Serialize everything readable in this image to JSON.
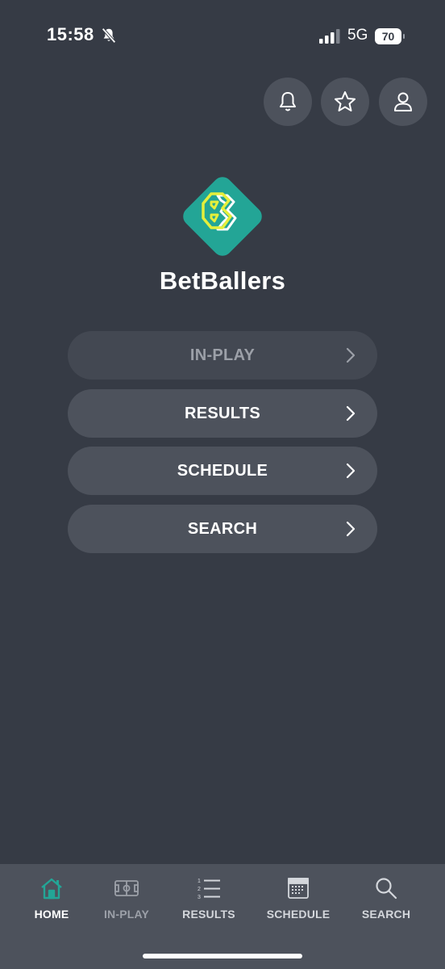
{
  "status_bar": {
    "time": "15:58",
    "network": "5G",
    "battery": "70"
  },
  "header": {
    "buttons": [
      {
        "icon": "bell-icon"
      },
      {
        "icon": "star-icon"
      },
      {
        "icon": "user-icon"
      }
    ]
  },
  "brand": {
    "name": "BetBallers",
    "colors": {
      "teal": "#23a596",
      "yellow": "#e5ef3b"
    }
  },
  "menu": {
    "items": [
      {
        "label": "IN-PLAY",
        "enabled": false
      },
      {
        "label": "RESULTS",
        "enabled": true
      },
      {
        "label": "SCHEDULE",
        "enabled": true
      },
      {
        "label": "SEARCH",
        "enabled": true
      }
    ]
  },
  "tabs": {
    "items": [
      {
        "label": "HOME",
        "icon": "home-icon",
        "active": true
      },
      {
        "label": "IN-PLAY",
        "icon": "pitch-icon",
        "active": false
      },
      {
        "label": "RESULTS",
        "icon": "numbered-list-icon",
        "active": false
      },
      {
        "label": "SCHEDULE",
        "icon": "calendar-icon",
        "active": false
      },
      {
        "label": "SEARCH",
        "icon": "search-icon",
        "active": false
      }
    ]
  },
  "colors": {
    "background": "#363b45",
    "surface": "#4d525c",
    "accent": "#23a596"
  }
}
